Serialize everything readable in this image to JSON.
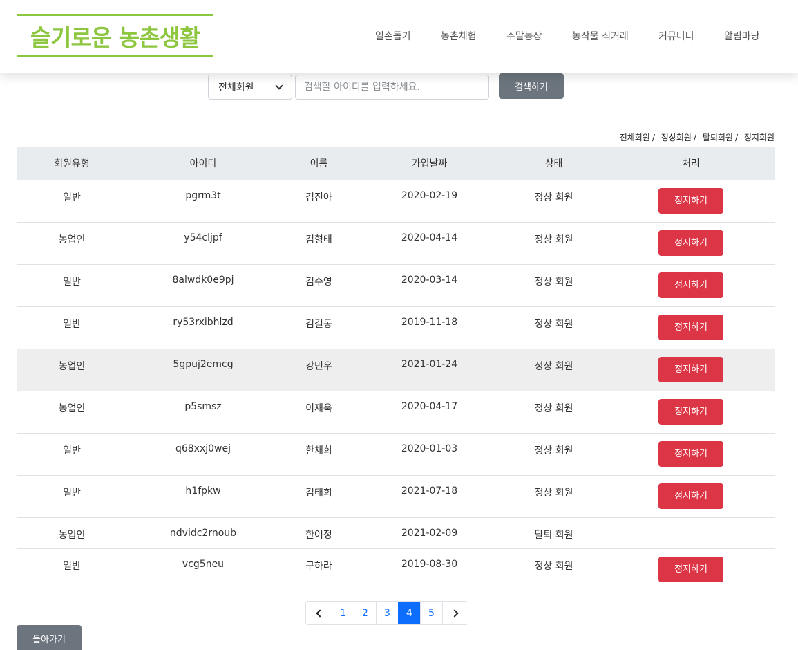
{
  "header": {
    "logo_text": "슬기로운 농촌생활",
    "nav": [
      "일손돕기",
      "농촌체험",
      "주말농장",
      "농작물 직거래",
      "커뮤니티",
      "알림마당"
    ]
  },
  "search": {
    "select_value": "전체회원",
    "placeholder": "검색할 아이디를 입력하세요.",
    "button_label": "검색하기"
  },
  "filters": [
    "전체회원",
    "정상회원",
    "탈퇴회원",
    "정지회원"
  ],
  "table": {
    "headers": [
      "회원유형",
      "아이디",
      "이름",
      "가입날짜",
      "상태",
      "처리"
    ],
    "rows": [
      {
        "type": "일반",
        "id": "pgrm3t",
        "name": "김진아",
        "date": "2020-02-19",
        "status": "정상 회원",
        "action": "정지하기"
      },
      {
        "type": "농업인",
        "id": "y54cljpf",
        "name": "김형태",
        "date": "2020-04-14",
        "status": "정상 회원",
        "action": "정지하기"
      },
      {
        "type": "일반",
        "id": "8alwdk0e9pj",
        "name": "김수영",
        "date": "2020-03-14",
        "status": "정상 회원",
        "action": "정지하기"
      },
      {
        "type": "일반",
        "id": "ry53rxibhlzd",
        "name": "김길동",
        "date": "2019-11-18",
        "status": "정상 회원",
        "action": "정지하기"
      },
      {
        "type": "농업인",
        "id": "5gpuj2emcg",
        "name": "강민우",
        "date": "2021-01-24",
        "status": "정상 회원",
        "action": "정지하기"
      },
      {
        "type": "농업인",
        "id": "p5smsz",
        "name": "이재욱",
        "date": "2020-04-17",
        "status": "정상 회원",
        "action": "정지하기"
      },
      {
        "type": "일반",
        "id": "q68xxj0wej",
        "name": "한채희",
        "date": "2020-01-03",
        "status": "정상 회원",
        "action": "정지하기"
      },
      {
        "type": "일반",
        "id": "h1fpkw",
        "name": "김태희",
        "date": "2021-07-18",
        "status": "정상 회원",
        "action": "정지하기"
      },
      {
        "type": "농업인",
        "id": "ndvidc2rnoub",
        "name": "한여정",
        "date": "2021-02-09",
        "status": "탈퇴 회원",
        "action": ""
      },
      {
        "type": "일반",
        "id": "vcg5neu",
        "name": "구하라",
        "date": "2019-08-30",
        "status": "정상 회원",
        "action": "정지하기"
      }
    ]
  },
  "pagination": {
    "pages": [
      "1",
      "2",
      "3",
      "4",
      "5"
    ],
    "current": "4"
  },
  "back_label": "돌아가기",
  "colors": {
    "brand_green": "#8dc63f",
    "danger": "#dc3545",
    "secondary": "#6c757d",
    "primary": "#0d6efd"
  }
}
